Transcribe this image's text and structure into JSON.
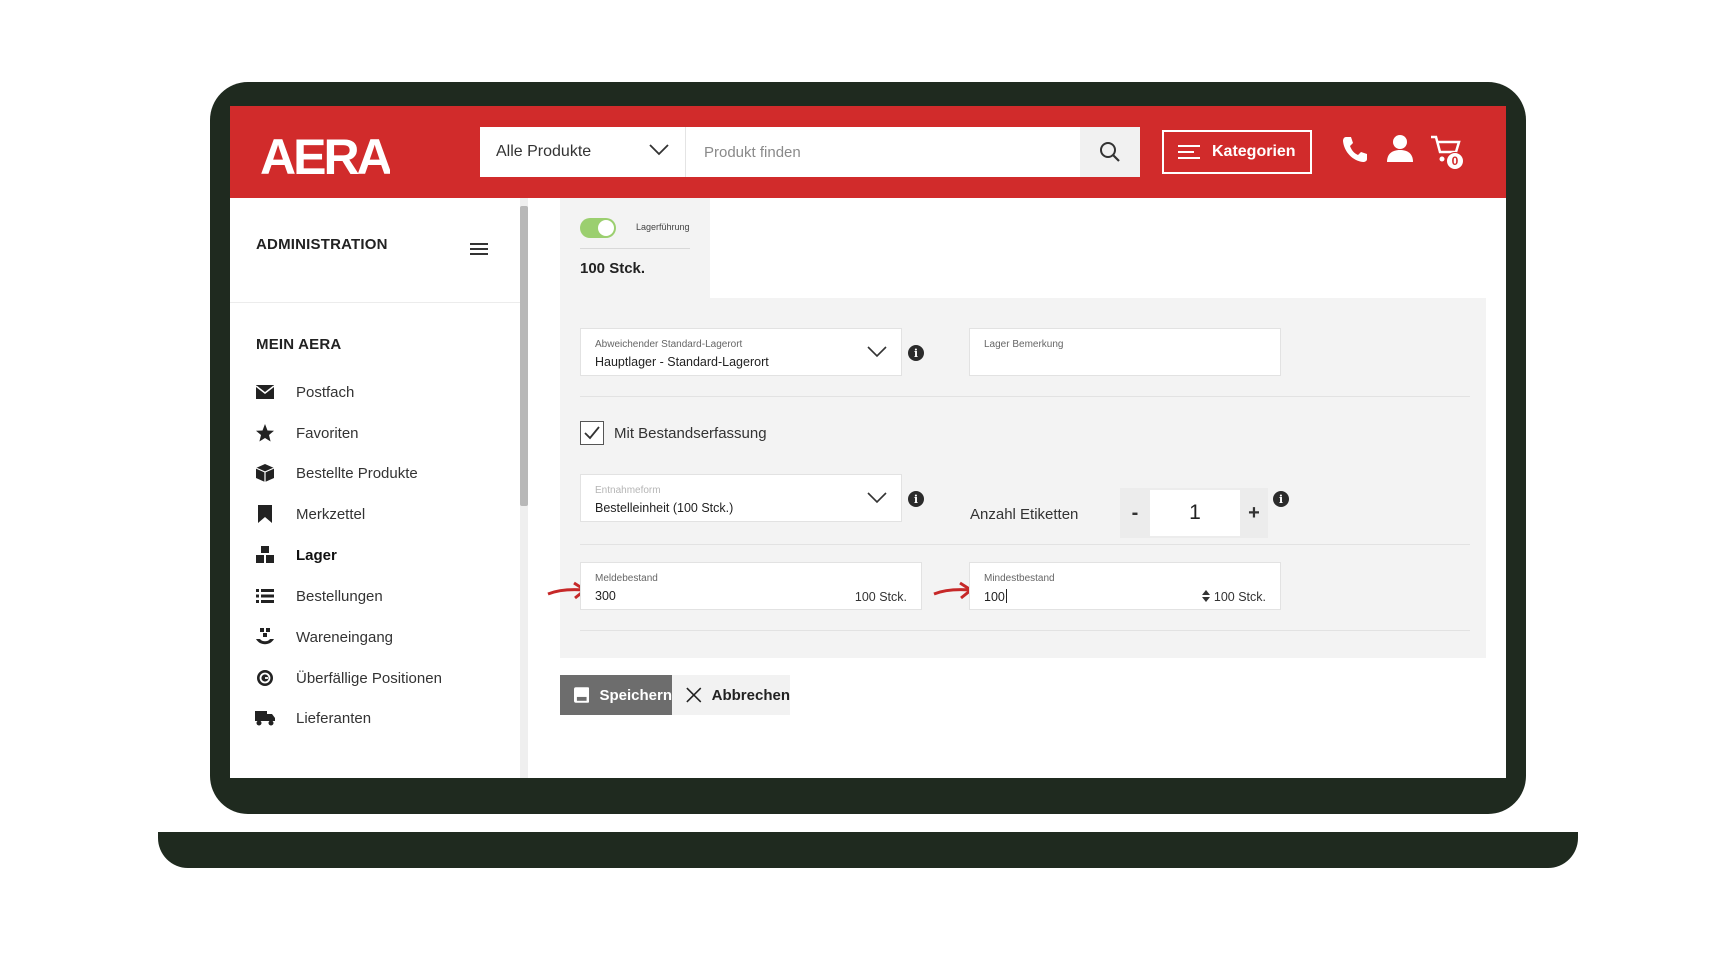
{
  "header": {
    "logo_text": "AERA",
    "category_select": "Alle Produkte",
    "search_placeholder": "Produkt finden",
    "categories_button": "Kategorien",
    "cart_count": "0",
    "brand_color": "#d12b2b"
  },
  "sidebar": {
    "section_admin": "ADMINISTRATION",
    "section_main": "MEIN AERA",
    "items": [
      {
        "label": "Postfach",
        "icon": "envelope-icon"
      },
      {
        "label": "Favoriten",
        "icon": "star-icon"
      },
      {
        "label": "Bestellte Produkte",
        "icon": "box-icon"
      },
      {
        "label": "Merkzettel",
        "icon": "bookmark-icon"
      },
      {
        "label": "Lager",
        "icon": "warehouse-icon",
        "active": true
      },
      {
        "label": "Bestellungen",
        "icon": "list-icon"
      },
      {
        "label": "Wareneingang",
        "icon": "incoming-goods-icon"
      },
      {
        "label": "Überfällige Positionen",
        "icon": "overdue-icon"
      },
      {
        "label": "Lieferanten",
        "icon": "truck-icon"
      }
    ]
  },
  "main": {
    "toggle_label": "Lagerführung",
    "toggle_on": true,
    "stock_value": "100 Stck.",
    "storage_location": {
      "label": "Abweichender Standard-Lagerort",
      "value": "Hauptlager - Standard-Lagerort"
    },
    "storage_note": {
      "label": "Lager Bemerkung",
      "value": ""
    },
    "inventory_check": {
      "label": "Mit Bestandserfassung",
      "checked": true
    },
    "withdrawal_form": {
      "label": "Entnahmeform",
      "value": "Bestelleinheit (100 Stck.)"
    },
    "labels_count": {
      "label": "Anzahl Etiketten",
      "value": "1",
      "minus": "-",
      "plus": "+"
    },
    "reorder_level": {
      "label": "Meldebestand",
      "value": "300",
      "unit": "100 Stck."
    },
    "min_stock": {
      "label": "Mindestbestand",
      "value": "100",
      "unit": "100 Stck."
    },
    "save_button": "Speichern",
    "cancel_button": "Abbrechen"
  }
}
